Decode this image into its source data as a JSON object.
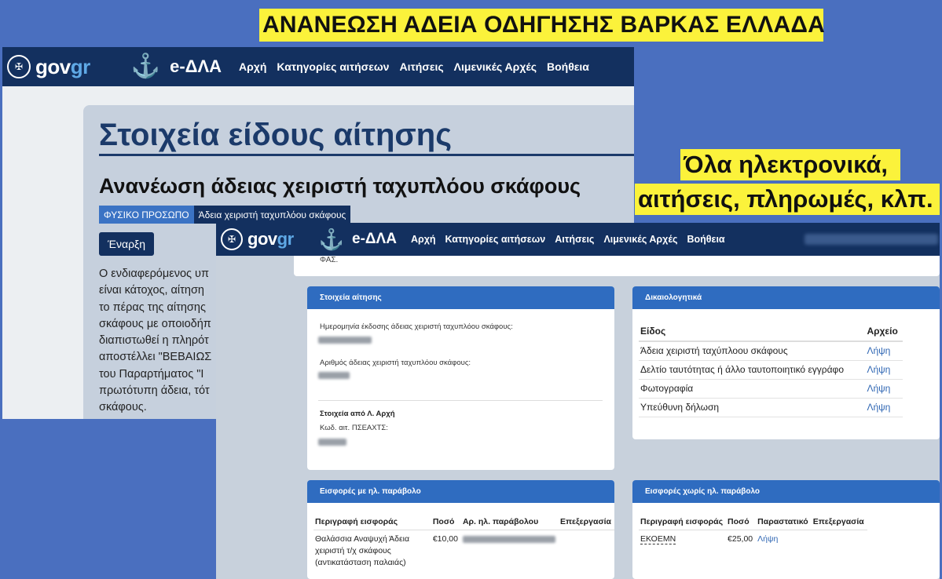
{
  "captions": {
    "top": "ΑΝΑΝΕΩΣΗ ΑΔΕΙΑ ΟΔΗΓΗΣΗΣ ΒΑΡΚΑΣ ΕΛΛΑΔΑ",
    "right_line1": "Όλα ηλεκτρονικά,",
    "right_line2": "αιτήσεις, πληρωμές, κλπ."
  },
  "header": {
    "govgr_left": "gov",
    "govgr_right": "gr",
    "edla": "e-ΔΛΑ",
    "menu": [
      "Αρχή",
      "Κατηγορίες αιτήσεων",
      "Αιτήσεις",
      "Λιμενικές Αρχές",
      "Βοήθεια"
    ]
  },
  "shot1": {
    "title": "Στοιχεία είδους αίτησης",
    "subtitle": "Ανανέωση άδειας χειριστή ταχυπλόου σκάφους",
    "tag_person": "ΦΥΣΙΚΟ ΠΡΟΣΩΠΟ",
    "tag_license": "Άδεια χειριστή ταχυπλόου σκάφους",
    "start_button": "Έναρξη",
    "description_lines": [
      "Ο ενδιαφερόμενος υπ",
      "είναι κάτοχος, αίτηση",
      "το πέρας της αίτησης",
      "σκάφους με οποιοδήπ",
      "διαπιστωθεί η πληρότ",
      "αποστέλλει \"ΒΕΒΑΙΩΣ",
      "του Παραρτήματος \"Ι",
      "πρωτότυπη άδεια, τότ",
      "σκάφους."
    ]
  },
  "shot2": {
    "top_fragment": "ΦΑΣ.",
    "application": {
      "header": "Στοιχεία αίτησης",
      "issue_date_label": "Ημερομηνία έκδοσης άδειας χειριστή ταχυπλόου σκάφους:",
      "license_number_label": "Αριθμός άδειας χειριστή ταχυπλόου σκάφους:",
      "authority_heading": "Στοιχεία από Λ. Αρχή",
      "authority_code_label": "Κωδ. αιτ. ΠΣΕΑΧΤΣ:"
    },
    "documents": {
      "header": "Δικαιολογητικά",
      "col_type": "Είδος",
      "col_file": "Αρχείο",
      "rows": [
        {
          "name": "Άδεια χειριστή ταχύπλοου σκάφους",
          "file": "Λήψη"
        },
        {
          "name": "Δελτίο ταυτότητας ή άλλο ταυτοποιητικό εγγράφο",
          "file": "Λήψη"
        },
        {
          "name": "Φωτογραφία",
          "file": "Λήψη"
        },
        {
          "name": "Υπεύθυνη δήλωση",
          "file": "Λήψη"
        }
      ]
    },
    "fees_with_paravolo": {
      "header": "Εισφορές με ηλ. παράβολο",
      "cols": [
        "Περιγραφή εισφοράς",
        "Ποσό",
        "Αρ. ηλ. παράβολου",
        "Επεξεργασία"
      ],
      "row": {
        "description_lines": [
          "Θαλάσσια Αναψυχή Άδεια",
          "χειριστή τ/χ σκάφους",
          "(αντικατάσταση παλαιάς)"
        ],
        "amount": "€10,00"
      }
    },
    "fees_without_paravolo": {
      "header": "Εισφορές χωρίς ηλ. παράβολο",
      "cols": [
        "Περιγραφή εισφοράς",
        "Ποσό",
        "Παραστατικό",
        "Επεξεργασία"
      ],
      "row": {
        "description": "ΕΚΟΕΜΝ",
        "amount": "€25,00",
        "receipt": "Λήψη"
      }
    }
  }
}
